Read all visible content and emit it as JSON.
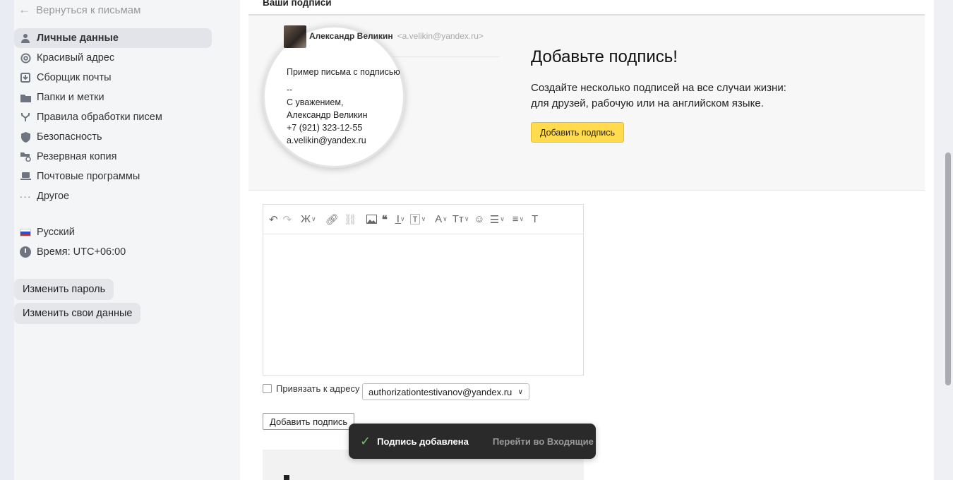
{
  "sidebar": {
    "back_label": "Вернуться к письмам",
    "items": [
      {
        "label": "Личные данные",
        "icon": "person-icon",
        "active": true
      },
      {
        "label": "Красивый адрес",
        "icon": "at-icon"
      },
      {
        "label": "Сборщик почты",
        "icon": "inbox-download-icon"
      },
      {
        "label": "Папки и метки",
        "icon": "folder-icon"
      },
      {
        "label": "Правила обработки писем",
        "icon": "rules-icon"
      },
      {
        "label": "Безопасность",
        "icon": "shield-icon"
      },
      {
        "label": "Резервная копия",
        "icon": "backup-folder-icon"
      },
      {
        "label": "Почтовые программы",
        "icon": "laptop-icon"
      },
      {
        "label": "Другое",
        "icon": "more-dots-icon"
      }
    ],
    "language": "Русский",
    "timezone": "Время: UTC+06:00",
    "change_password": "Изменить пароль",
    "change_data": "Изменить свои данные"
  },
  "main": {
    "section_title": "Ваши подписи",
    "sample": {
      "sender_name": "Александр Великин",
      "sender_email": "<a.velikin@yandex.ru>",
      "body": "Пример письма с подписью",
      "dashes": "--",
      "line1": "С уважением,",
      "line2": "Александр Великин",
      "line3": "+7 (921) 323-12-55",
      "line4": "a.velikin@yandex.ru"
    },
    "promo_title": "Добавьте подпись!",
    "promo_text1": "Создайте несколько подписей на все случаи жизни:",
    "promo_text2": "для друзей, рабочую или на английском языке.",
    "promo_button": "Добавить подпись",
    "bind_label": "Привязать к адресу",
    "bind_address": "authorizationtestivanov@yandex.ru",
    "add_button": "Добавить подпись"
  },
  "toast": {
    "message": "Подпись добавлена",
    "link": "Перейти во Входящие"
  }
}
